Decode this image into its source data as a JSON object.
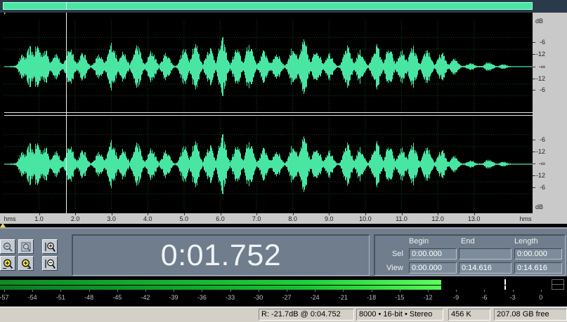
{
  "overview": {
    "name": "overview-bar"
  },
  "waveform": {
    "color": "#49e6a3",
    "background": "#000000",
    "grid_color": "#0a4a18",
    "cursor_time_seconds": 1.752,
    "duration_seconds": 14.616,
    "channels": [
      "left",
      "right"
    ]
  },
  "db_scale": {
    "unit_label": "dB",
    "labels": [
      "-6",
      "-12",
      "-∞",
      "-12",
      "-6"
    ]
  },
  "ruler": {
    "unit_label": "hms",
    "unit_label_right": "hms",
    "ticks": [
      "1.0",
      "2.0",
      "3.0",
      "4.0",
      "5.0",
      "6.0",
      "7.0",
      "8.0",
      "9.0",
      "10.0",
      "11.0",
      "12.0",
      "13.0"
    ]
  },
  "tools": [
    {
      "name": "zoom-out-full-icon"
    },
    {
      "name": "zoom-selection-icon"
    },
    {
      "name": "zoom-in-vertical-icon"
    },
    {
      "name": "zoom-in-left-icon"
    },
    {
      "name": "zoom-in-right-icon"
    },
    {
      "name": "zoom-out-vertical-icon"
    }
  ],
  "time_display": "0:01.752",
  "selection": {
    "headers": {
      "begin": "Begin",
      "end": "End",
      "length": "Length"
    },
    "sel": {
      "label": "Sel",
      "begin": "0:00.000",
      "end": "",
      "length": "0:00.000"
    },
    "view": {
      "label": "View",
      "begin": "0:00.000",
      "end": "0:14.616",
      "length": "0:14.616"
    }
  },
  "meter": {
    "level_db": -11.5,
    "peak_db": -2,
    "labels": [
      "-57",
      "-54",
      "-51",
      "-48",
      "-45",
      "-42",
      "-39",
      "-36",
      "-33",
      "-30",
      "-27",
      "-24",
      "-21",
      "-18",
      "-15",
      "-12",
      "-9",
      "-6",
      "-3",
      "0"
    ]
  },
  "status": {
    "cursor_info": "R: -21.7dB @   0:04.752",
    "format": "8000 • 16-bit • Stereo",
    "size": "456 K",
    "free": "207.08 GB free"
  }
}
